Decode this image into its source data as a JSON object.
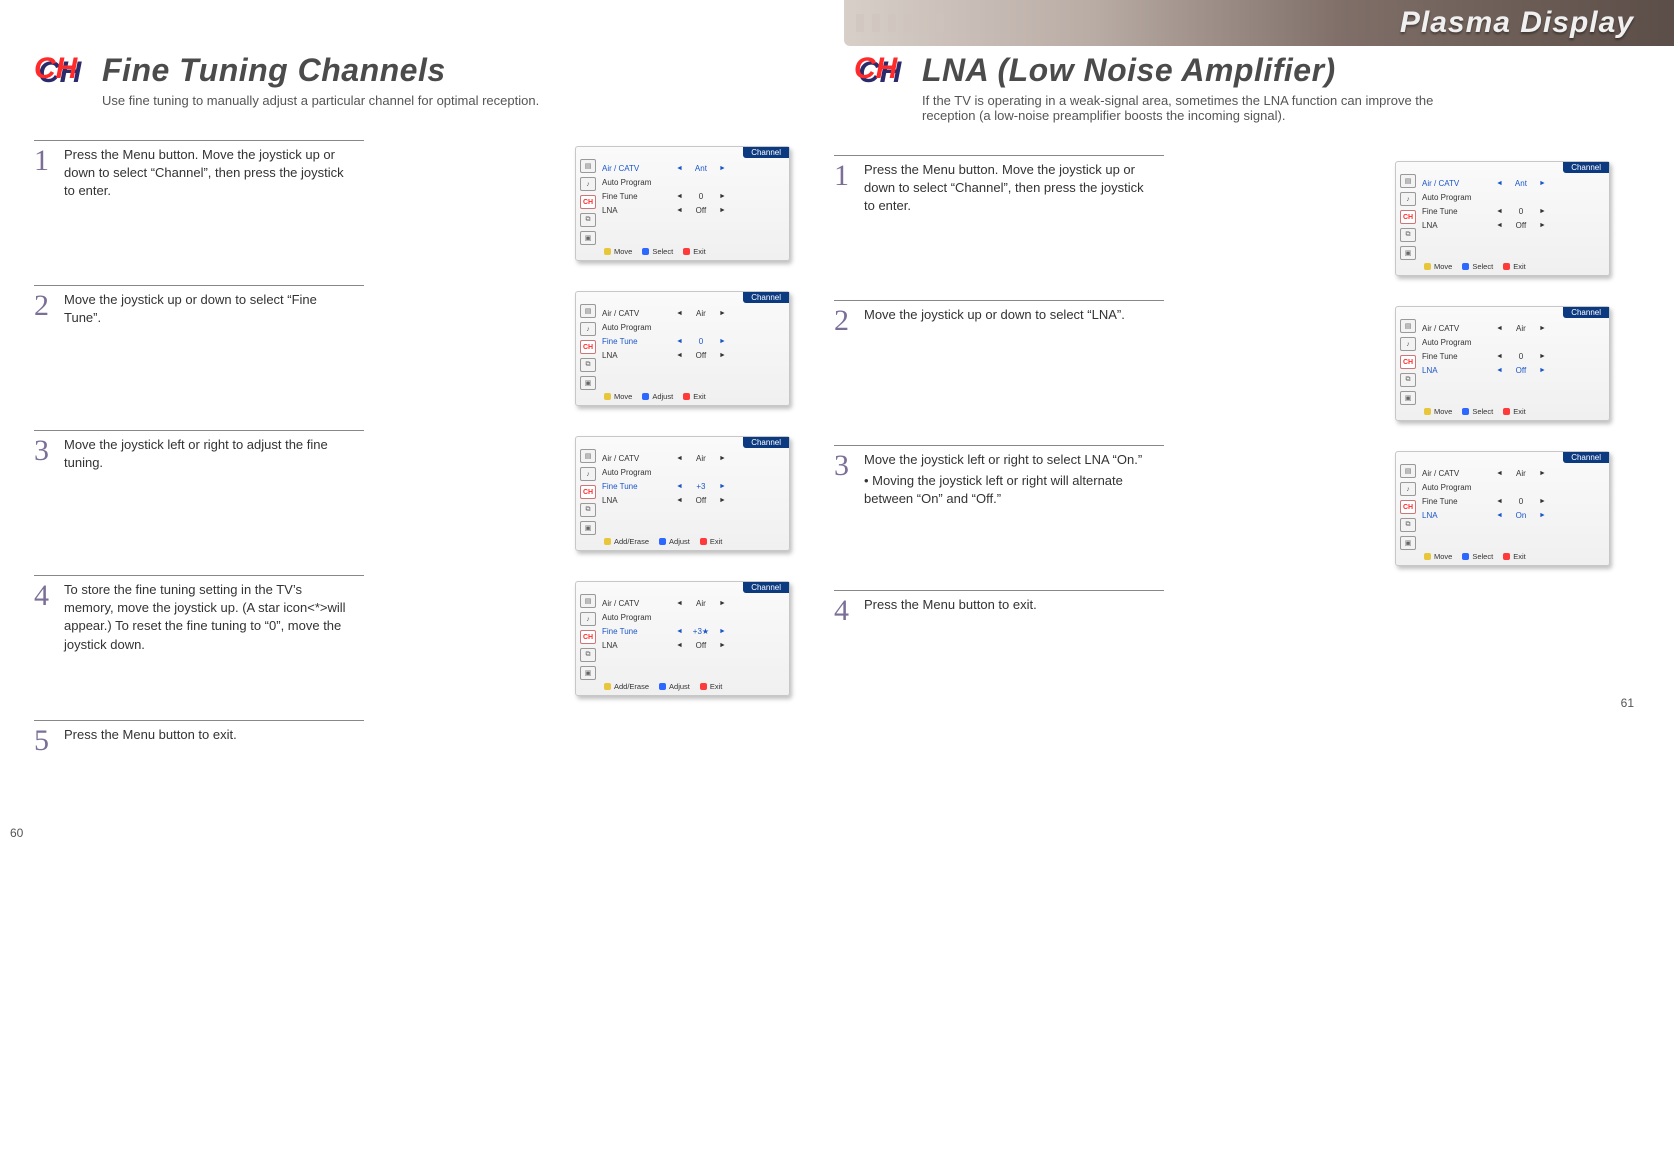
{
  "banner": "Plasma Display",
  "ch_logo": "CH",
  "osd_common": {
    "title": "Channel",
    "labels": {
      "air": "Air / CATV",
      "auto": "Auto Program",
      "fine": "Fine Tune",
      "lna": "LNA"
    },
    "foot": {
      "move": "Move",
      "select": "Select",
      "adjust": "Adjust",
      "adderase": "Add/Erase",
      "exit": "Exit"
    }
  },
  "left": {
    "title": "Fine Tuning Channels",
    "sub": "Use fine tuning to manually adjust a particular channel for optimal reception.",
    "page": "60",
    "steps": [
      {
        "n": "1",
        "text": "Press the Menu button. Move the joystick up or down to select “Channel”, then press the joystick to enter.",
        "osd": {
          "hl": 0,
          "air": "Ant",
          "fine": "0",
          "lna": "Off",
          "foot": [
            "move",
            "select",
            "exit"
          ]
        }
      },
      {
        "n": "2",
        "text": "Move the joystick up or down to select “Fine Tune”.",
        "osd": {
          "hl": 2,
          "air": "Air",
          "fine": "0",
          "lna": "Off",
          "foot": [
            "move",
            "adjust",
            "exit"
          ]
        }
      },
      {
        "n": "3",
        "text": "Move the joystick left or right to adjust the fine tuning.",
        "osd": {
          "hl": 2,
          "air": "Air",
          "fine": "+3",
          "lna": "Off",
          "foot": [
            "adderase",
            "adjust",
            "exit"
          ]
        }
      },
      {
        "n": "4",
        "text": "To store the fine tuning setting in the TV’s memory, move the joystick up. (A star icon<*>will appear.) To reset the fine tuning to “0”, move the joystick down.",
        "osd": {
          "hl": 2,
          "air": "Air",
          "fine": "+3★",
          "lna": "Off",
          "foot": [
            "adderase",
            "adjust",
            "exit"
          ]
        }
      },
      {
        "n": "5",
        "text": "Press the Menu button to exit.",
        "osd": null
      }
    ]
  },
  "right": {
    "title": "LNA (Low Noise Amplifier)",
    "sub": "If the TV is operating in a weak-signal area, sometimes the LNA function can improve the reception (a low-noise preamplifier boosts the incoming signal).",
    "page": "61",
    "steps": [
      {
        "n": "1",
        "text": "Press the Menu button. Move the joystick up or down to select “Channel”, then press the joystick to enter.",
        "osd": {
          "hl": 0,
          "air": "Ant",
          "fine": "0",
          "lna": "Off",
          "foot": [
            "move",
            "select",
            "exit"
          ]
        }
      },
      {
        "n": "2",
        "text": "Move the joystick up or down to select “LNA”.",
        "osd": {
          "hl": 3,
          "air": "Air",
          "fine": "0",
          "lna": "Off",
          "foot": [
            "move",
            "select",
            "exit"
          ]
        }
      },
      {
        "n": "3",
        "text": "Move the joystick left or right to select LNA “On.”",
        "bullet": "• Moving the joystick left or right will alternate between “On” and “Off.”",
        "osd": {
          "hl": 3,
          "air": "Air",
          "fine": "0",
          "lna": "On",
          "foot": [
            "move",
            "select",
            "exit"
          ]
        }
      },
      {
        "n": "4",
        "text": "Press the Menu button to exit.",
        "osd": null
      }
    ]
  }
}
